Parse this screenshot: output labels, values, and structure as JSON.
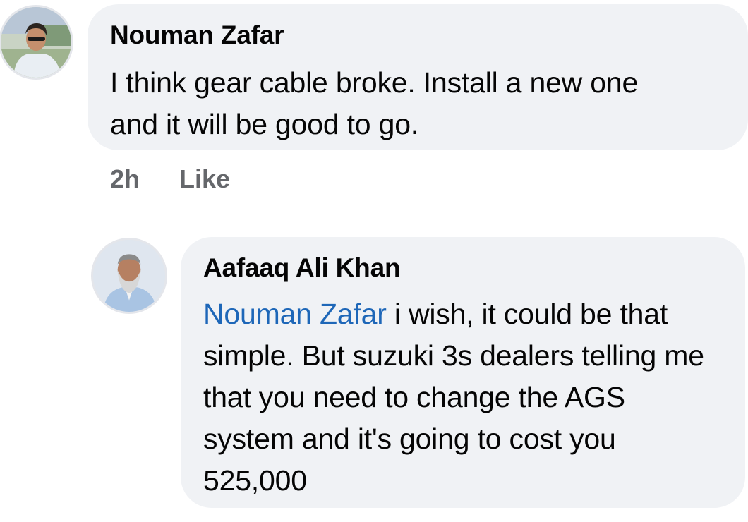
{
  "comments": [
    {
      "author": "Nouman Zafar",
      "text": "I think gear cable broke. Install a new one and it will be good to go.",
      "time": "2h",
      "like_label": "Like"
    }
  ],
  "replies": [
    {
      "author": "Aafaaq Ali Khan",
      "mention": "Nouman Zafar",
      "text": " i wish, it could be that simple. But suzuki 3s dealers telling me that you need to change the AGS system and it's going to cost you 525,000"
    }
  ],
  "colors": {
    "bubble": "#f0f2f5",
    "mention": "#1e67b8",
    "meta": "#65676b"
  }
}
